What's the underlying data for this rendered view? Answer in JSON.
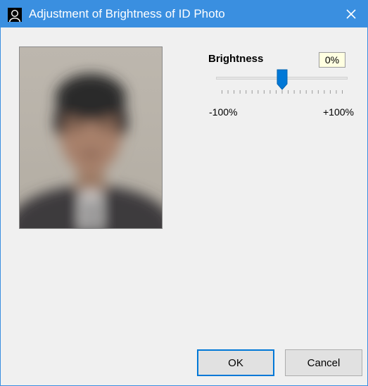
{
  "window": {
    "title": "Adjustment of Brightness of ID Photo",
    "app_icon": "person-silhouette-icon",
    "close_icon": "close-icon",
    "accent": "#3a8fe0"
  },
  "photo": {
    "description_icon": "portrait-photo"
  },
  "brightness": {
    "label": "Brightness",
    "value": "0%",
    "slider_value": 0,
    "min": -100,
    "max": 100,
    "min_label": "-100%",
    "max_label": "+100%"
  },
  "buttons": {
    "ok_label": "OK",
    "cancel_label": "Cancel"
  }
}
